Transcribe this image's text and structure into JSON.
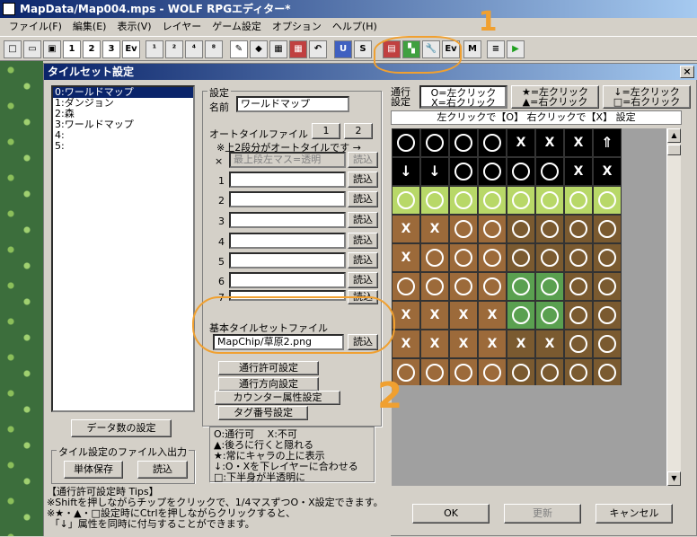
{
  "window": {
    "title": "MapData/Map004.mps - WOLF RPGエディター*"
  },
  "menu": [
    "ファイル(F)",
    "編集(E)",
    "表示(V)",
    "レイヤー",
    "ゲーム設定",
    "オプション",
    "ヘルプ(H)"
  ],
  "toolbar": {
    "layer_buttons": [
      "1",
      "2",
      "3",
      "Ev"
    ]
  },
  "dialog": {
    "title": "タイルセット設定",
    "close": "×",
    "tilesets": [
      "0:ワールドマップ",
      "1:ダンジョン",
      "2:森",
      "3:ワールドマップ",
      "4:",
      "5:"
    ],
    "btn_data_count": "データ数の設定",
    "fileio_group": "タイル設定のファイル入出力",
    "btn_save_single": "単体保存",
    "btn_load": "読込",
    "settings_group": "設定",
    "name_label": "名前",
    "name_value": "ワールドマップ",
    "autotile_label": "オートタイルファイル",
    "autotile_p1": "1",
    "autotile_p2": "2",
    "autotile_note": "※上2段分がオートタイルです →",
    "autotile_x_label": "×",
    "autotile_x_value": "最上段左マス=透明",
    "autotile_rows": [
      "1",
      "2",
      "3",
      "4",
      "5",
      "6",
      "7"
    ],
    "read_label": "読込",
    "base_tile_label": "基本タイルセットファイル",
    "base_tile_value": "MapChip/草原2.png",
    "btn_pass": "通行許可設定",
    "btn_dir": "通行方向設定",
    "btn_counter": "カウンター属性設定",
    "btn_tag": "タグ番号設定",
    "legend": [
      "O:通行可　 X:不可",
      "▲:後ろに行くと隠れる",
      "★:常にキャラの上に表示",
      "↓:O・Xを下レイヤーに合わせる",
      "□:下半身が半透明に"
    ],
    "mode_label": "通行\n設定",
    "mode_btn1_l1": "O=左クリック",
    "mode_btn1_l2": "X=右クリック",
    "mode_btn2_l1": "★=左クリック",
    "mode_btn2_l2": "▲=右クリック",
    "mode_btn3_l1": "↓=左クリック",
    "mode_btn3_l2": "□=右クリック",
    "instruction": "左クリックで【O】 右クリックで【X】 設定",
    "tiles": [
      [
        "O",
        "O",
        "O",
        "O",
        "X",
        "X",
        "X",
        "⇑"
      ],
      [
        "↓",
        "↓",
        "O",
        "O",
        "O",
        "O",
        "X",
        "X"
      ],
      [
        "O",
        "O",
        "O",
        "O",
        "O",
        "O",
        "O",
        "O"
      ],
      [
        "X",
        "X",
        "O",
        "O",
        "O",
        "O",
        "O",
        "O"
      ],
      [
        "X",
        "O",
        "O",
        "O",
        "O",
        "O",
        "O",
        "O"
      ],
      [
        "O",
        "O",
        "O",
        "O",
        "O",
        "O",
        "O",
        "O"
      ],
      [
        "X",
        "X",
        "X",
        "X",
        "O",
        "O",
        "O",
        "O"
      ],
      [
        "X",
        "X",
        "X",
        "X",
        "X",
        "X",
        "O",
        "O"
      ],
      [
        "O",
        "O",
        "O",
        "O",
        "O",
        "O",
        "O",
        "O"
      ]
    ],
    "tips": "【通行許可設定時 Tips】\n※Shiftを押しながらチップをクリックで、1/4マスずつO・X設定できます。\n※★・▲・□設定時にCtrlを押しながらクリックすると、\n 「↓」属性を同時に付与することができます。",
    "btn_ok": "OK",
    "btn_apply": "更新",
    "btn_cancel": "キャンセル"
  },
  "annotations": {
    "one": "1",
    "two": "2"
  }
}
